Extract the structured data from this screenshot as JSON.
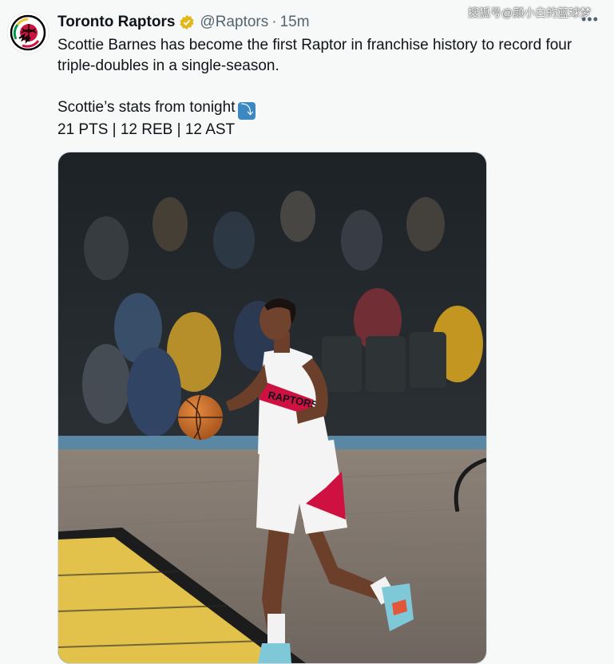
{
  "account": {
    "display_name": "Toronto Raptors",
    "handle": "@Raptors",
    "separator": "·",
    "time_ago": "15m",
    "verified_icon": "verified-badge-icon",
    "avatar_icon": "raptors-logo-icon"
  },
  "menu": {
    "more_label": "•••"
  },
  "watermark": {
    "text": "搜狐号@颜小白的篮球梦"
  },
  "tweet": {
    "line1": "Scottie Barnes has become the first Raptor in franchise history to record four triple-doubles in a single-season.",
    "line2": "Scottie’s stats from tonight",
    "arrow_emoji": "⤵",
    "line3": "21 PTS | 12 REB | 12 AST"
  },
  "media": {
    "description_icon": "basketball-photo",
    "jersey_text": "RAPTORS"
  },
  "colors": {
    "brand_red": "#ce1141",
    "verified_gold": "#e2b719",
    "text_primary": "#0f1419",
    "text_secondary": "#536471",
    "background": "#f7f9f9"
  }
}
